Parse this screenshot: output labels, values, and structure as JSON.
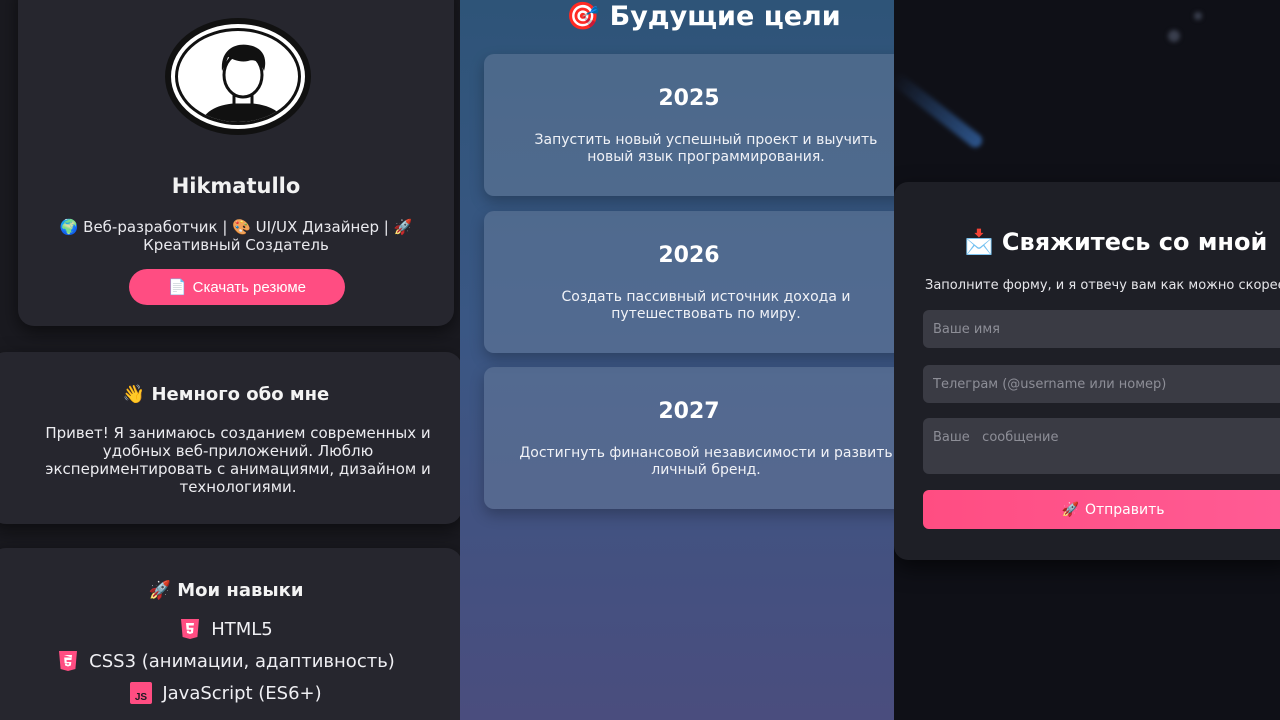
{
  "profile": {
    "name": "Hikmatullo",
    "role": "🌍 Веб-разработчик | 🎨 UI/UX Дизайнер | 🚀 Креативный Создатель",
    "resume_button": "Скачать резюме",
    "resume_icon": "📄"
  },
  "about": {
    "icon": "👋",
    "title": "Немного обо мне",
    "text": "Привет! Я занимаюсь созданием современных и удобных веб-приложений. Люблю экспериментировать с анимациями, дизайном и технологиями."
  },
  "skills": {
    "icon": "🚀",
    "title": "Мои навыки",
    "items": [
      {
        "label": "HTML5",
        "icon": "html5-icon",
        "color": "#ff4d82"
      },
      {
        "label": "CSS3 (анимации, адаптивность)",
        "icon": "css3-icon",
        "color": "#ff4d82"
      },
      {
        "label": "JavaScript (ES6+)",
        "icon": "js-icon",
        "color": "#ff4d82"
      }
    ]
  },
  "goals": {
    "icon": "🎯",
    "title": "Будущие цели",
    "items": [
      {
        "year": "2025",
        "text": "Запустить новый успешный проект и выучить\nновый язык программирования."
      },
      {
        "year": "2026",
        "text": "Создать пассивный источник дохода и\nпутешествовать по миру."
      },
      {
        "year": "2027",
        "text": "Достигнуть финансовой независимости и развить\nличный бренд."
      }
    ]
  },
  "contact": {
    "icon": "📩",
    "title": "Свяжитесь со мной",
    "subtitle": "Заполните форму, и я отвечу вам как можно скорее",
    "name_placeholder": "Ваше имя",
    "telegram_placeholder": "Телеграм (@username или номер)",
    "message_placeholder": "Ваше   сообщение",
    "send_icon": "🚀",
    "send_label": "Отправить"
  },
  "colors": {
    "accent": "#ff4d82",
    "card": "#26262e",
    "middle_gradient_top": "#2e5478",
    "middle_gradient_bottom": "#4a4d7e"
  }
}
